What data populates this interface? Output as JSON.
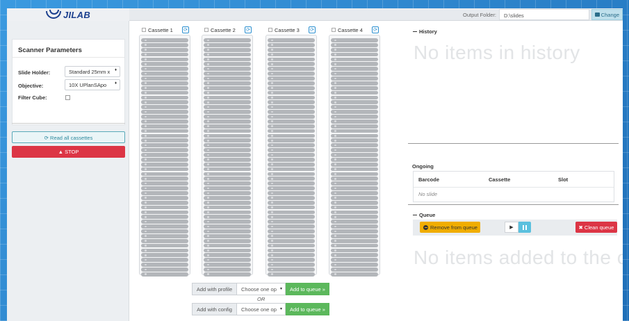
{
  "app": {
    "brand": "JILAB"
  },
  "topbar": {
    "output_label": "Output Folder:",
    "output_value": "D:\\slides",
    "change_label": "Change"
  },
  "sidebar": {
    "params_title": "Scanner Parameters",
    "slide_holder_label": "Slide Holder:",
    "slide_holder_value": "Standard 25mm x",
    "objective_label": "Objective:",
    "objective_value": "10X UPlanSApo",
    "filter_cube_label": "Filter Cube:",
    "read_all_label": "Read all cassettes",
    "stop_label": "STOP"
  },
  "cassettes": [
    {
      "label": "Cassette 1"
    },
    {
      "label": "Cassette 2"
    },
    {
      "label": "Cassette 3"
    },
    {
      "label": "Cassette 4"
    }
  ],
  "add": {
    "profile_label": "Add with profile",
    "config_label": "Add with config",
    "choose_placeholder": "Choose one op",
    "queue_label": "Add to queue »",
    "or_label": "OR"
  },
  "history": {
    "title": "History",
    "empty": "No items in history"
  },
  "ongoing": {
    "title": "Ongoing",
    "columns": [
      "Barcode",
      "Cassette",
      "Slot"
    ],
    "empty": "No slide"
  },
  "queue": {
    "title": "Queue",
    "remove_label": "Remove from queue",
    "clean_label": "✖ Clean queue",
    "empty": "No items added to the c"
  }
}
